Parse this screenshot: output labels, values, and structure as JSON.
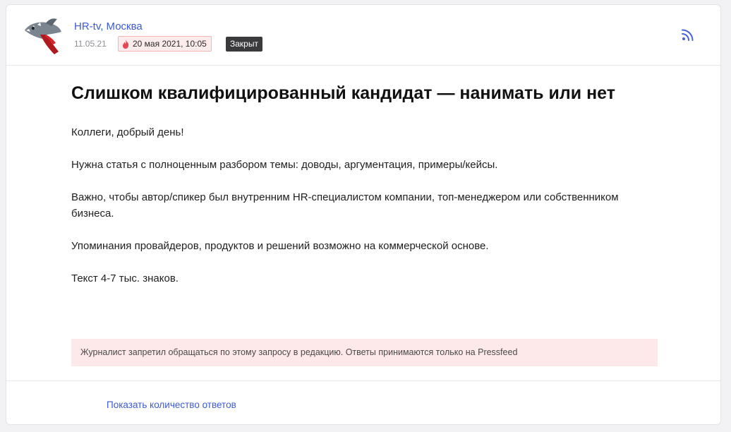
{
  "header": {
    "source": "HR-tv, Москва",
    "post_date": "11.05.21",
    "deadline": "20 мая 2021, 10:05",
    "status": "Закрыт",
    "rss_icon": "rss-icon",
    "deadline_icon": "fire-icon"
  },
  "article": {
    "title": "Слишком квалифицированный кандидат —  нанимать или нет",
    "paragraphs": [
      "Коллеги, добрый день!",
      "Нужна статья с полноценным разбором темы: доводы, аргументация, примеры/кейсы.",
      "Важно, чтобы автор/спикер был внутренним HR-специалистом компании, топ-менеджером или собственником бизнеса.",
      "Упоминания провайдеров, продуктов и решений возможно на коммерческой основе.",
      "Текст 4-7 тыс. знаков."
    ]
  },
  "notice": "Журналист запретил обращаться по этому запросу в редакцию. Ответы принимаются только на Pressfeed",
  "footer": {
    "show_count_label": "Показать количество ответов"
  },
  "colors": {
    "link": "#3d5ad8",
    "status_bg": "#3a3a3c",
    "deadline_bg": "#fdecec",
    "notice_bg": "#fde8ea"
  }
}
